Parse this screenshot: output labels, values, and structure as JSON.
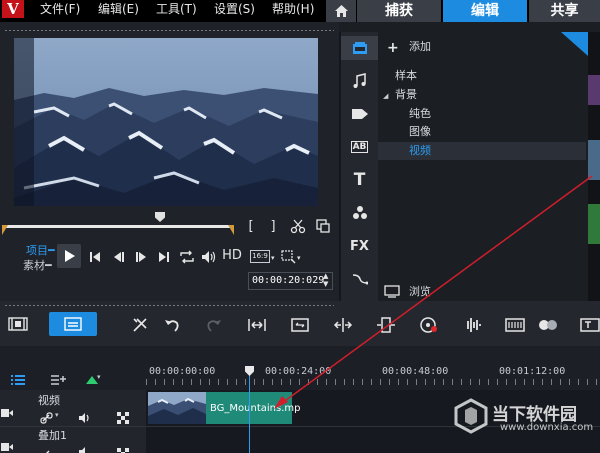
{
  "app": {
    "logo_letter": "V"
  },
  "menu": [
    "文件(F)",
    "编辑(E)",
    "工具(T)",
    "设置(S)",
    "帮助(H)"
  ],
  "tabs": {
    "capture": "捕获",
    "edit": "编辑",
    "share": "共享"
  },
  "player": {
    "mode_project": "项目",
    "mode_clip": "素材",
    "hd_label": "HD",
    "aspect_ratio": "16:9",
    "timecode": "00:00:20:029"
  },
  "library": {
    "add_label": "添加",
    "tree": {
      "samples": "样本",
      "background": "背景",
      "solid": "纯色",
      "image": "图像",
      "video": "视频"
    },
    "browse_label": "浏览",
    "tools": [
      "media",
      "audio",
      "transition",
      "title-ab",
      "text",
      "effects",
      "FX",
      "motion"
    ],
    "fx_label": "FX",
    "title_label": "AB",
    "text_label": "T"
  },
  "timeline": {
    "ruler": [
      "00:00:00:00",
      "00:00:24:00",
      "00:00:48:00",
      "00:01:12:00"
    ],
    "tracks": [
      {
        "name": "视频"
      },
      {
        "name": "叠加1"
      }
    ],
    "clip_name": "BG_Mountains.mp"
  },
  "watermark": {
    "brand": "当下软件园",
    "url": "www.downxia.com"
  },
  "colors": {
    "accent": "#1d8ce0",
    "clip": "#1f8a78",
    "logo": "#c3121a",
    "scrub_cap": "#d49a3a"
  }
}
